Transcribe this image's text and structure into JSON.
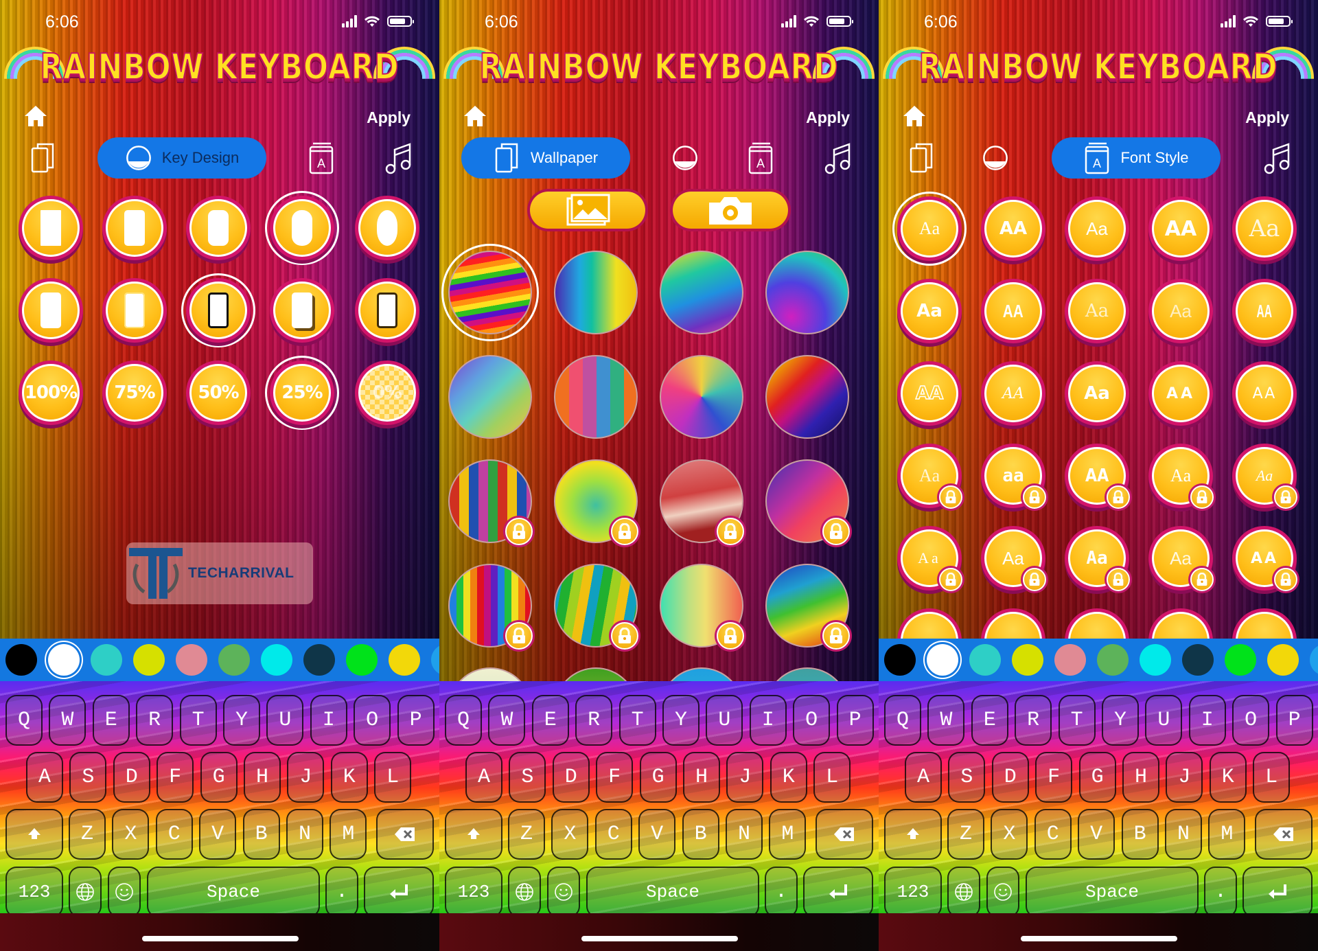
{
  "app_title": "RAINBOW KEYBOARD",
  "status_time": "6:06",
  "apply_label": "Apply",
  "tabs": {
    "wallpaper": "Wallpaper",
    "key_design": "Key Design",
    "font_style": "Font Style",
    "sound": "Sound"
  },
  "panels": [
    {
      "id": "key-design",
      "active_tab": "Key Design"
    },
    {
      "id": "wallpaper",
      "active_tab": "Wallpaper"
    },
    {
      "id": "font-style",
      "active_tab": "Font Style"
    }
  ],
  "key_design": {
    "shape_row_1": [
      "sharp-rect",
      "slight-round",
      "round",
      "pill-selected",
      "oval"
    ],
    "shape_row_1_selected_index": 3,
    "border_row_2": [
      "none",
      "thin-outline",
      "black-outline-selected",
      "shadow",
      "dark-border"
    ],
    "border_row_2_selected_index": 2,
    "opacity_options": [
      "100%",
      "75%",
      "50%",
      "25%",
      "0%"
    ],
    "opacity_selected_index": 3
  },
  "wallpaper": {
    "gallery_button": "gallery-icon",
    "camera_button": "camera-icon",
    "thumbnails": [
      {
        "name": "rainbow-waves",
        "locked": false,
        "selected": true
      },
      {
        "name": "vertical-stripes",
        "locked": false
      },
      {
        "name": "swoosh",
        "locked": false
      },
      {
        "name": "bubbles",
        "locked": false
      },
      {
        "name": "diagonal-streaks",
        "locked": false
      },
      {
        "name": "crayons",
        "locked": false
      },
      {
        "name": "swirl",
        "locked": false
      },
      {
        "name": "diagonal-rays",
        "locked": false
      },
      {
        "name": "wood-planks",
        "locked": true
      },
      {
        "name": "ripple",
        "locked": true
      },
      {
        "name": "silk",
        "locked": true
      },
      {
        "name": "blur-streaks",
        "locked": true
      },
      {
        "name": "spectrum-stripes",
        "locked": true
      },
      {
        "name": "green-yellow-stripes",
        "locked": true
      },
      {
        "name": "pastel-gradient",
        "locked": true
      },
      {
        "name": "smoke",
        "locked": true
      }
    ]
  },
  "font_style": {
    "labels": [
      "Aa",
      "AA",
      "Aa",
      "AA",
      "Aa",
      "Aa",
      "AA",
      "Aa",
      "Aa",
      "AA",
      "AA",
      "AA",
      "Aa",
      "AA",
      "AA",
      "Aa",
      "aa",
      "AA",
      "Aa",
      "Aa",
      "Aa",
      "Aa",
      "Aa",
      "Aa",
      "AA"
    ],
    "locked_from_index": 15,
    "selected_index": 0
  },
  "colors": {
    "swatches": [
      "#000000",
      "#ffffff",
      "#2ecfc6",
      "#d6e000",
      "#e08a94",
      "#5db35a",
      "#00eaea",
      "#0f3548",
      "#00e21a",
      "#f2d80a",
      "#1fa0ec"
    ],
    "selected_index": 1,
    "strip_color": "#1478e0",
    "accent_tab": "#1477e6",
    "button_fill": "#ffbf1a",
    "button_border": "#d3146a"
  },
  "keyboard": {
    "row1": [
      "Q",
      "W",
      "E",
      "R",
      "T",
      "Y",
      "U",
      "I",
      "O",
      "P"
    ],
    "row2": [
      "A",
      "S",
      "D",
      "F",
      "G",
      "H",
      "J",
      "K",
      "L"
    ],
    "row3": [
      "Z",
      "X",
      "C",
      "V",
      "B",
      "N",
      "M"
    ],
    "numbers_key": "123",
    "space_key": "Space",
    "period_key": "."
  },
  "watermark": "TECHARRIVAL"
}
